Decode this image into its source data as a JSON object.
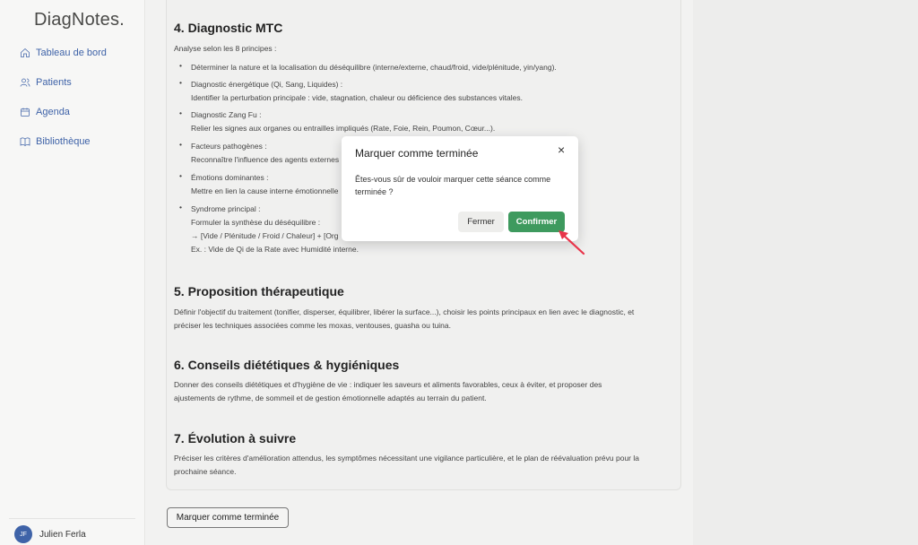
{
  "app": {
    "logo": "DiagNotes."
  },
  "sidebar": {
    "items": [
      {
        "label": "Tableau de bord",
        "icon": "home-icon"
      },
      {
        "label": "Patients",
        "icon": "users-icon"
      },
      {
        "label": "Agenda",
        "icon": "calendar-icon"
      },
      {
        "label": "Bibliothèque",
        "icon": "book-icon"
      }
    ],
    "user": {
      "initials": "JF",
      "name": "Julien Ferla"
    }
  },
  "content": {
    "s4": {
      "title": "4. Diagnostic MTC",
      "intro": "Analyse selon les 8 principes :",
      "bullets": [
        [
          "Déterminer la nature et la localisation du déséquilibre (interne/externe, chaud/froid, vide/plénitude, yin/yang)."
        ],
        [
          "Diagnostic énergétique (Qi, Sang, Liquides) :",
          "Identifier la perturbation principale : vide, stagnation, chaleur ou déficience des substances vitales."
        ],
        [
          "Diagnostic Zang Fu :",
          "Relier les signes aux organes ou entrailles impliqués (Rate, Foie, Rein, Poumon, Cœur...)."
        ],
        [
          "Facteurs pathogènes :",
          "Reconnaître l'influence des agents externes"
        ],
        [
          "Émotions dominantes :",
          "Mettre en lien la cause interne émotionnelle"
        ],
        [
          "Syndrome principal :",
          "Formuler la synthèse du déséquilibre :",
          "→ [Vide / Plénitude / Froid / Chaleur] + [Org",
          "Ex. : Vide de Qi de la Rate avec Humidité interne."
        ]
      ]
    },
    "s5": {
      "title": "5. Proposition thérapeutique",
      "lines": [
        "Définir l'objectif du traitement (tonifier, disperser, équilibrer, libérer la surface...), choisir les points principaux en lien avec le diagnostic, et",
        "préciser les techniques associées comme les moxas, ventouses, guasha ou tuina."
      ]
    },
    "s6": {
      "title": "6. Conseils diététiques & hygiéniques",
      "lines": [
        "Donner des conseils diététiques et d'hygiène de vie : indiquer les saveurs et aliments favorables, ceux à éviter, et proposer des",
        "ajustements de rythme, de sommeil et de gestion émotionnelle adaptés au terrain du patient."
      ]
    },
    "s7": {
      "title": "7. Évolution à suivre",
      "lines": [
        "Préciser les critères d'amélioration attendus, les symptômes nécessitant une vigilance particulière, et le plan de réévaluation prévu pour la",
        "prochaine séance."
      ]
    },
    "mark_button": "Marquer comme terminée"
  },
  "modal": {
    "title": "Marquer comme terminée",
    "close_icon": "×",
    "body": "Êtes-vous sûr de vouloir marquer cette séance comme terminée ?",
    "cancel": "Fermer",
    "confirm": "Confirmer",
    "confirm_color": "#3e9a5e"
  }
}
